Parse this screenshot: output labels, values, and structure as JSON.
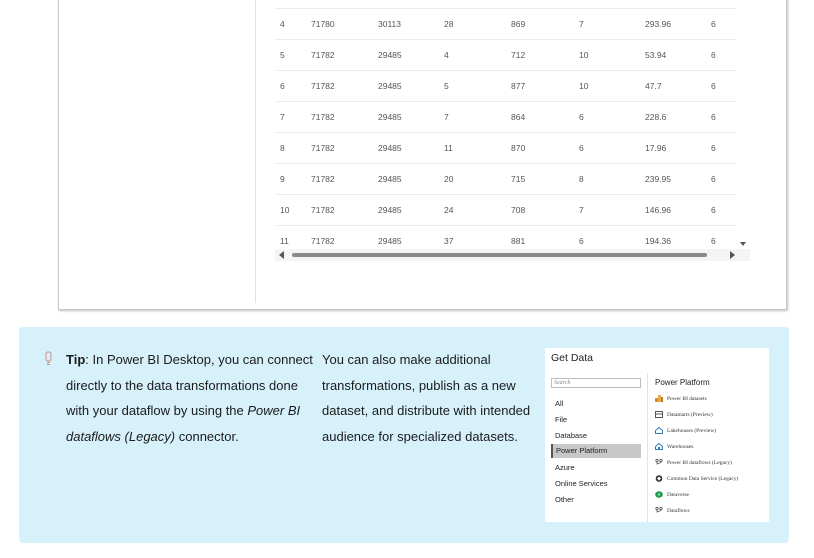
{
  "table": {
    "rows": [
      [
        "4",
        "71780",
        "30113",
        "28",
        "869",
        "7",
        "293.96",
        "6"
      ],
      [
        "5",
        "71782",
        "29485",
        "4",
        "712",
        "10",
        "53.94",
        "6"
      ],
      [
        "6",
        "71782",
        "29485",
        "5",
        "877",
        "10",
        "47.7",
        "6"
      ],
      [
        "7",
        "71782",
        "29485",
        "7",
        "864",
        "6",
        "228.6",
        "6"
      ],
      [
        "8",
        "71782",
        "29485",
        "11",
        "870",
        "6",
        "17.96",
        "6"
      ],
      [
        "9",
        "71782",
        "29485",
        "20",
        "715",
        "8",
        "239.95",
        "6"
      ],
      [
        "10",
        "71782",
        "29485",
        "24",
        "708",
        "7",
        "146.96",
        "6"
      ],
      [
        "11",
        "71782",
        "29485",
        "37",
        "881",
        "6",
        "194.36",
        "6"
      ]
    ]
  },
  "tip": {
    "label": "Tip",
    "col1_text": ": In Power BI Desktop, you can connect directly to the data transformations done with your dataflow by using the ",
    "col1_emph": "Power BI dataflows (Legacy)",
    "col1_end": " connector.",
    "col2_text": "You can also make additional transformations, publish as a new dataset, and distribute with intended audience for specialized datasets."
  },
  "get_data": {
    "title": "Get Data",
    "search_placeholder": "Search",
    "categories": [
      "All",
      "File",
      "Database",
      "Power Platform",
      "Azure",
      "Online Services",
      "Other"
    ],
    "selected_category": "Power Platform",
    "section_title": "Power Platform",
    "items": [
      {
        "label": "Power BI datasets",
        "icon": "datasets-icon",
        "color": "#d98b2b"
      },
      {
        "label": "Datamarts (Preview)",
        "icon": "datamart-icon",
        "color": "#555555"
      },
      {
        "label": "Lakehouses (Preview)",
        "icon": "lakehouse-icon",
        "color": "#2f7fc1"
      },
      {
        "label": "Warehouses",
        "icon": "warehouse-icon",
        "color": "#2f7fc1"
      },
      {
        "label": "Power BI dataflows (Legacy)",
        "icon": "dataflow-icon",
        "color": "#555555"
      },
      {
        "label": "Common Data Service (Legacy)",
        "icon": "cds-icon",
        "color": "#333333"
      },
      {
        "label": "Dataverse",
        "icon": "dataverse-icon",
        "color": "#1e9b4a"
      },
      {
        "label": "Dataflows",
        "icon": "dataflows-icon",
        "color": "#555555"
      }
    ]
  }
}
